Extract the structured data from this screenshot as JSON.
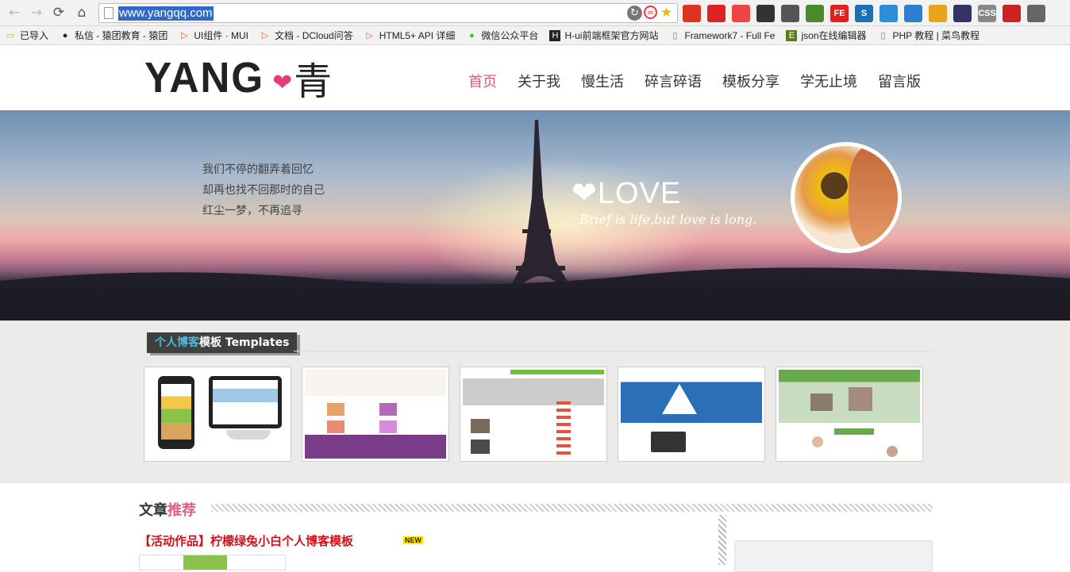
{
  "browser": {
    "url": "www.yangqq.com",
    "ext_icons": [
      "extension-icon",
      "adblock-icon",
      "gmail-icon",
      "bug-icon",
      "ruler-icon",
      "book-icon",
      "fe-icon",
      "s-icon",
      "download-icon",
      "screenshot-icon",
      "chrome-icon",
      "dropper-icon",
      "css-icon",
      "forward-icon",
      "puzzle-icon"
    ],
    "ext_labels": [
      "",
      "",
      "",
      "",
      "",
      "",
      "FE",
      "S",
      "",
      "",
      "",
      "",
      "CSS",
      "",
      ""
    ]
  },
  "bookmarks": [
    {
      "label": "已导入",
      "icon": "folder-icon"
    },
    {
      "label": "私信 - 猿团教育 - 猿团",
      "icon": "github-icon"
    },
    {
      "label": "UI组件 · MUI",
      "icon": "dcloud-icon"
    },
    {
      "label": "文档 - DCloud问答",
      "icon": "dcloud-icon"
    },
    {
      "label": "HTML5+ API 详细",
      "icon": "dcloud-icon"
    },
    {
      "label": "微信公众平台",
      "icon": "wechat-icon"
    },
    {
      "label": "H-ui前端框架官方网站",
      "icon": "hui-icon"
    },
    {
      "label": "Framework7 - Full Fe",
      "icon": "page-icon"
    },
    {
      "label": "json在线编辑器",
      "icon": "e-icon"
    },
    {
      "label": "PHP 教程 | 菜鸟教程",
      "icon": "page-icon"
    }
  ],
  "site": {
    "logo_text": "YANG",
    "logo_cn": "青",
    "nav": [
      "首页",
      "关于我",
      "慢生活",
      "碎言碎语",
      "模板分享",
      "学无止境",
      "留言版"
    ],
    "active_nav": "首页"
  },
  "banner": {
    "lines": [
      "我们不停的翻弄着回忆",
      "却再也找不回那时的自己",
      "红尘一梦，不再追寻"
    ],
    "love": "LOVE",
    "love_sub": "Brief is life,but love is long."
  },
  "templates": {
    "title_hl": "个人博客",
    "title_rest": "模板 Templates",
    "count": 5
  },
  "articles": {
    "head": "文章",
    "head_hl": "推荐",
    "first_title": "【活动作品】柠檬绿兔小白个人博客模板",
    "badge": "NEW"
  },
  "colors": {
    "accent": "#e05a82",
    "title_blue": "#4db9dd",
    "article_red": "#d0111a"
  }
}
